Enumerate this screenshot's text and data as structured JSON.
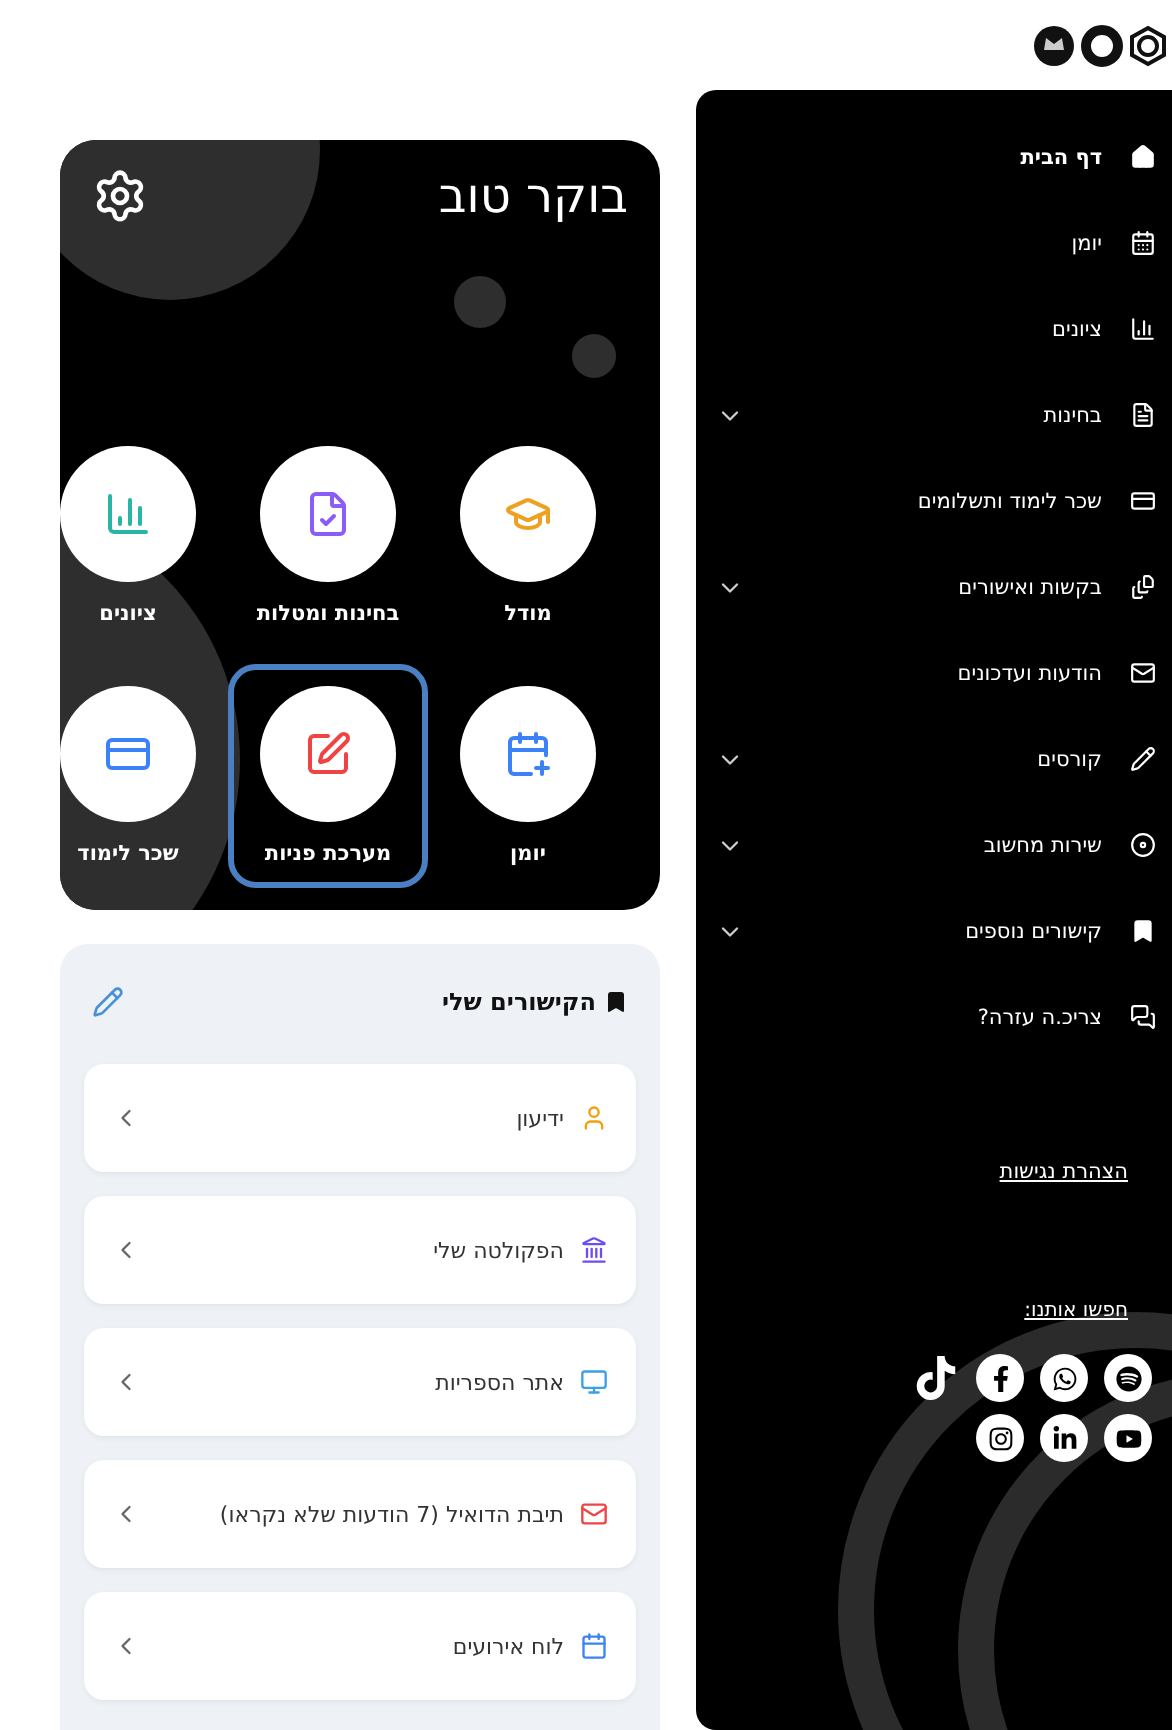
{
  "sidebar": {
    "nav": [
      {
        "label": "דף הבית",
        "kind": "home",
        "selected": true,
        "expandable": false
      },
      {
        "label": "יומן",
        "kind": "calendar",
        "selected": false,
        "expandable": false
      },
      {
        "label": "ציונים",
        "kind": "grades",
        "selected": false,
        "expandable": false
      },
      {
        "label": "בחינות",
        "kind": "exams",
        "selected": false,
        "expandable": true
      },
      {
        "label": "שכר לימוד ותשלומים",
        "kind": "payments",
        "selected": false,
        "expandable": false
      },
      {
        "label": "בקשות ואישורים",
        "kind": "requests",
        "selected": false,
        "expandable": true
      },
      {
        "label": "הודעות ועדכונים",
        "kind": "messages",
        "selected": false,
        "expandable": false
      },
      {
        "label": "קורסים",
        "kind": "courses",
        "selected": false,
        "expandable": true
      },
      {
        "label": "שירות מחשוב",
        "kind": "it",
        "selected": false,
        "expandable": true
      },
      {
        "label": "קישורים נוספים",
        "kind": "links",
        "selected": false,
        "expandable": true
      },
      {
        "label": "צריכ.ה עזרה?",
        "kind": "help",
        "selected": false,
        "expandable": false
      }
    ],
    "accessibility_link": "הצהרת נגישות",
    "contact_label": "חפשו אותנו:"
  },
  "dashboard": {
    "greeting": "בוקר טוב",
    "tiles": [
      {
        "label": "מודל",
        "kind": "moodle",
        "selected": false
      },
      {
        "label": "בחינות ומטלות",
        "kind": "exams",
        "selected": false
      },
      {
        "label": "ציונים",
        "kind": "grades",
        "selected": false
      },
      {
        "label": "יומן",
        "kind": "calendar",
        "selected": false
      },
      {
        "label": "מערכת פניות",
        "kind": "inquiries",
        "selected": true
      },
      {
        "label": "שכר לימוד",
        "kind": "tuition",
        "selected": false
      }
    ]
  },
  "links": {
    "title": "הקישורים שלי",
    "items": [
      {
        "label": "ידיעון",
        "kind": "catalog"
      },
      {
        "label": "הפקולטה שלי",
        "kind": "faculty"
      },
      {
        "label": "אתר הספריות",
        "kind": "library"
      },
      {
        "label": "תיבת הדואיל (7 הודעות שלא נקראו)",
        "kind": "mail"
      },
      {
        "label": "לוח אירועים",
        "kind": "events"
      }
    ]
  }
}
